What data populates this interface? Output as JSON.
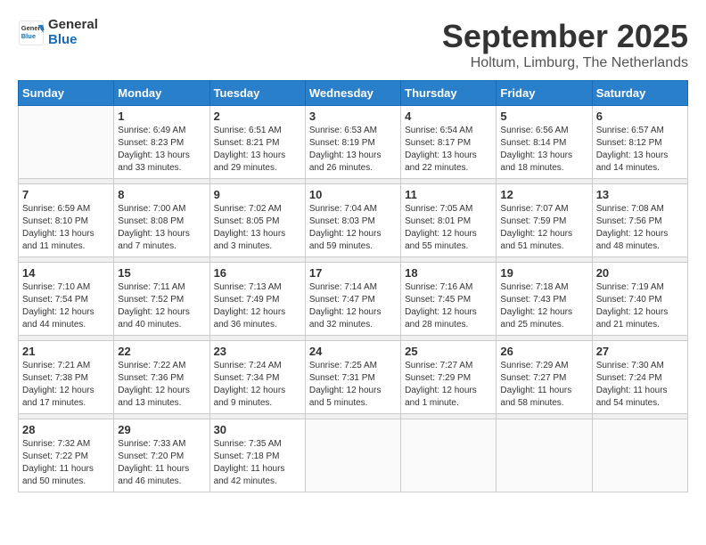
{
  "logo": {
    "general": "General",
    "blue": "Blue"
  },
  "title": "September 2025",
  "location": "Holtum, Limburg, The Netherlands",
  "weekdays": [
    "Sunday",
    "Monday",
    "Tuesday",
    "Wednesday",
    "Thursday",
    "Friday",
    "Saturday"
  ],
  "weeks": [
    [
      {
        "day": "",
        "info": ""
      },
      {
        "day": "1",
        "info": "Sunrise: 6:49 AM\nSunset: 8:23 PM\nDaylight: 13 hours\nand 33 minutes."
      },
      {
        "day": "2",
        "info": "Sunrise: 6:51 AM\nSunset: 8:21 PM\nDaylight: 13 hours\nand 29 minutes."
      },
      {
        "day": "3",
        "info": "Sunrise: 6:53 AM\nSunset: 8:19 PM\nDaylight: 13 hours\nand 26 minutes."
      },
      {
        "day": "4",
        "info": "Sunrise: 6:54 AM\nSunset: 8:17 PM\nDaylight: 13 hours\nand 22 minutes."
      },
      {
        "day": "5",
        "info": "Sunrise: 6:56 AM\nSunset: 8:14 PM\nDaylight: 13 hours\nand 18 minutes."
      },
      {
        "day": "6",
        "info": "Sunrise: 6:57 AM\nSunset: 8:12 PM\nDaylight: 13 hours\nand 14 minutes."
      }
    ],
    [
      {
        "day": "7",
        "info": "Sunrise: 6:59 AM\nSunset: 8:10 PM\nDaylight: 13 hours\nand 11 minutes."
      },
      {
        "day": "8",
        "info": "Sunrise: 7:00 AM\nSunset: 8:08 PM\nDaylight: 13 hours\nand 7 minutes."
      },
      {
        "day": "9",
        "info": "Sunrise: 7:02 AM\nSunset: 8:05 PM\nDaylight: 13 hours\nand 3 minutes."
      },
      {
        "day": "10",
        "info": "Sunrise: 7:04 AM\nSunset: 8:03 PM\nDaylight: 12 hours\nand 59 minutes."
      },
      {
        "day": "11",
        "info": "Sunrise: 7:05 AM\nSunset: 8:01 PM\nDaylight: 12 hours\nand 55 minutes."
      },
      {
        "day": "12",
        "info": "Sunrise: 7:07 AM\nSunset: 7:59 PM\nDaylight: 12 hours\nand 51 minutes."
      },
      {
        "day": "13",
        "info": "Sunrise: 7:08 AM\nSunset: 7:56 PM\nDaylight: 12 hours\nand 48 minutes."
      }
    ],
    [
      {
        "day": "14",
        "info": "Sunrise: 7:10 AM\nSunset: 7:54 PM\nDaylight: 12 hours\nand 44 minutes."
      },
      {
        "day": "15",
        "info": "Sunrise: 7:11 AM\nSunset: 7:52 PM\nDaylight: 12 hours\nand 40 minutes."
      },
      {
        "day": "16",
        "info": "Sunrise: 7:13 AM\nSunset: 7:49 PM\nDaylight: 12 hours\nand 36 minutes."
      },
      {
        "day": "17",
        "info": "Sunrise: 7:14 AM\nSunset: 7:47 PM\nDaylight: 12 hours\nand 32 minutes."
      },
      {
        "day": "18",
        "info": "Sunrise: 7:16 AM\nSunset: 7:45 PM\nDaylight: 12 hours\nand 28 minutes."
      },
      {
        "day": "19",
        "info": "Sunrise: 7:18 AM\nSunset: 7:43 PM\nDaylight: 12 hours\nand 25 minutes."
      },
      {
        "day": "20",
        "info": "Sunrise: 7:19 AM\nSunset: 7:40 PM\nDaylight: 12 hours\nand 21 minutes."
      }
    ],
    [
      {
        "day": "21",
        "info": "Sunrise: 7:21 AM\nSunset: 7:38 PM\nDaylight: 12 hours\nand 17 minutes."
      },
      {
        "day": "22",
        "info": "Sunrise: 7:22 AM\nSunset: 7:36 PM\nDaylight: 12 hours\nand 13 minutes."
      },
      {
        "day": "23",
        "info": "Sunrise: 7:24 AM\nSunset: 7:34 PM\nDaylight: 12 hours\nand 9 minutes."
      },
      {
        "day": "24",
        "info": "Sunrise: 7:25 AM\nSunset: 7:31 PM\nDaylight: 12 hours\nand 5 minutes."
      },
      {
        "day": "25",
        "info": "Sunrise: 7:27 AM\nSunset: 7:29 PM\nDaylight: 12 hours\nand 1 minute."
      },
      {
        "day": "26",
        "info": "Sunrise: 7:29 AM\nSunset: 7:27 PM\nDaylight: 11 hours\nand 58 minutes."
      },
      {
        "day": "27",
        "info": "Sunrise: 7:30 AM\nSunset: 7:24 PM\nDaylight: 11 hours\nand 54 minutes."
      }
    ],
    [
      {
        "day": "28",
        "info": "Sunrise: 7:32 AM\nSunset: 7:22 PM\nDaylight: 11 hours\nand 50 minutes."
      },
      {
        "day": "29",
        "info": "Sunrise: 7:33 AM\nSunset: 7:20 PM\nDaylight: 11 hours\nand 46 minutes."
      },
      {
        "day": "30",
        "info": "Sunrise: 7:35 AM\nSunset: 7:18 PM\nDaylight: 11 hours\nand 42 minutes."
      },
      {
        "day": "",
        "info": ""
      },
      {
        "day": "",
        "info": ""
      },
      {
        "day": "",
        "info": ""
      },
      {
        "day": "",
        "info": ""
      }
    ]
  ]
}
